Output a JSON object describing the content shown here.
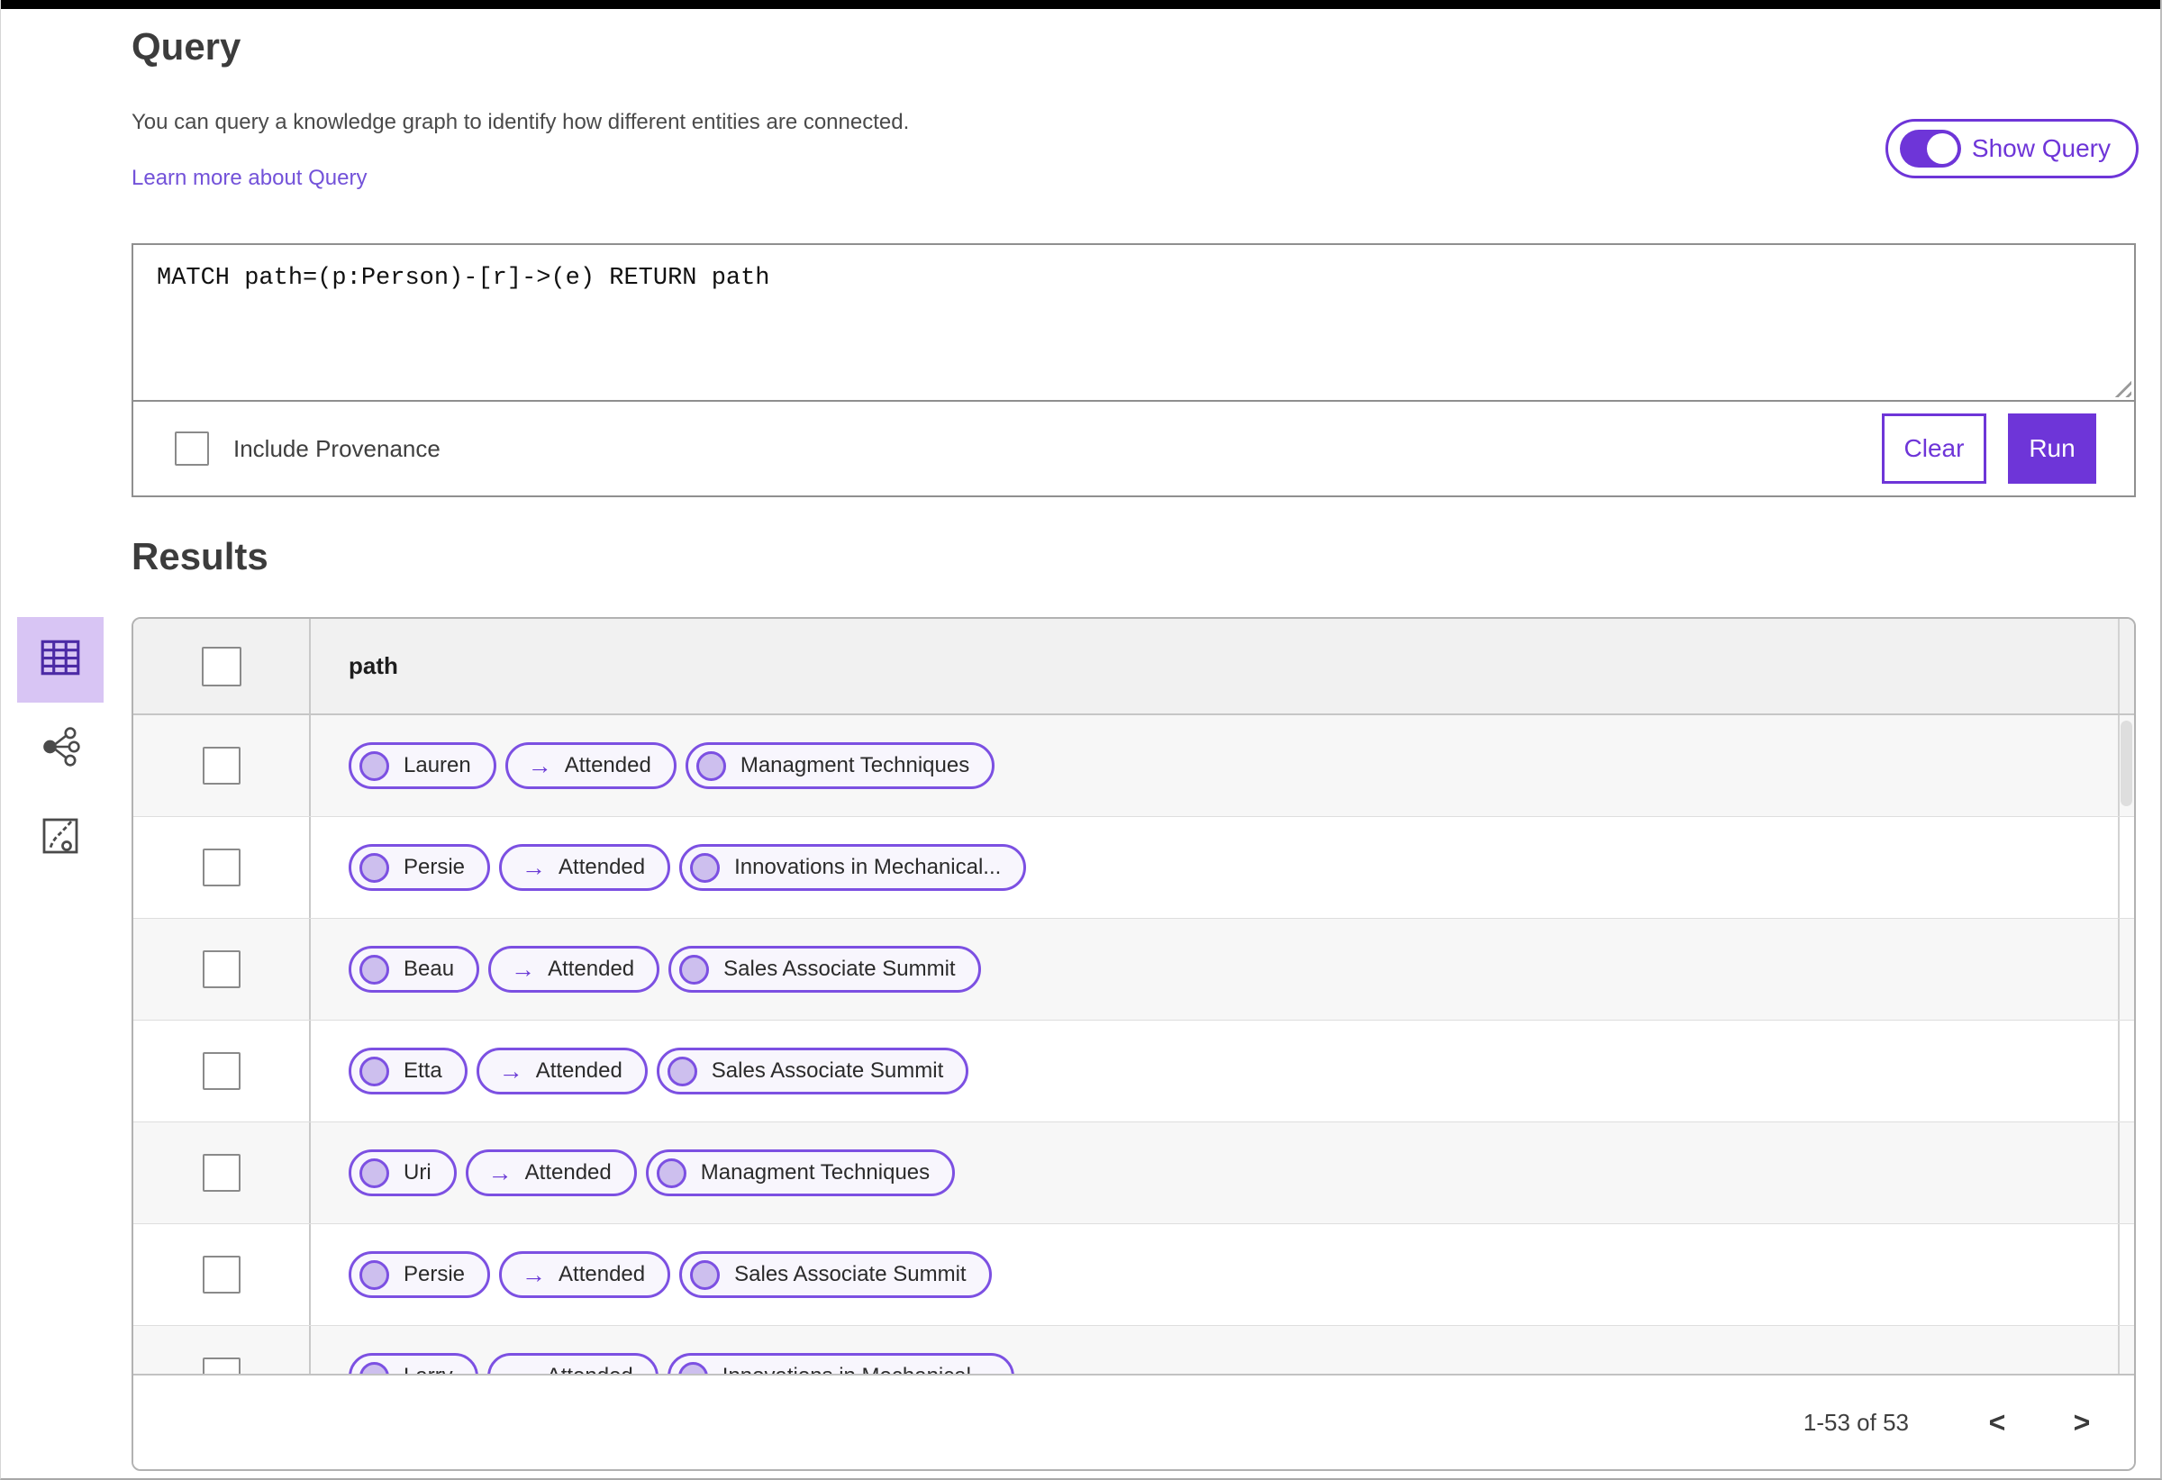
{
  "header": {
    "title": "Query",
    "description": "You can query a knowledge graph to identify how different entities are connected.",
    "learn_more_label": "Learn more about Query",
    "show_query_label": "Show Query",
    "show_query_on": true
  },
  "query_editor": {
    "query_text": "MATCH path=(p:Person)-[r]->(e) RETURN path",
    "include_provenance_label": "Include Provenance",
    "include_provenance_checked": false,
    "clear_button_label": "Clear",
    "run_button_label": "Run"
  },
  "results": {
    "title": "Results",
    "path_column_header": "path",
    "relation_arrow": "→",
    "view_modes": [
      {
        "name": "table-view",
        "selected": true
      },
      {
        "name": "graph-view",
        "selected": false
      },
      {
        "name": "chart-view",
        "selected": false
      }
    ],
    "rows": [
      {
        "source": "Lauren",
        "relation": "Attended",
        "target": "Managment Techniques"
      },
      {
        "source": "Persie",
        "relation": "Attended",
        "target": "Innovations in Mechanical..."
      },
      {
        "source": "Beau",
        "relation": "Attended",
        "target": "Sales Associate Summit"
      },
      {
        "source": "Etta",
        "relation": "Attended",
        "target": "Sales Associate Summit"
      },
      {
        "source": "Uri",
        "relation": "Attended",
        "target": "Managment Techniques"
      },
      {
        "source": "Persie",
        "relation": "Attended",
        "target": "Sales Associate Summit"
      },
      {
        "source": "Larry",
        "relation": "Attended",
        "target": "Innovations in Mechanical..."
      }
    ],
    "pagination": {
      "range_text": "1-53 of 53",
      "prev_icon": "<",
      "next_icon": ">"
    }
  },
  "colors": {
    "accent": "#6e35d8",
    "pill_border": "#7c50e2",
    "pill_bg": "#f8f6fd",
    "node_fill": "#cdbfee",
    "selected_tile_bg": "#d8c5f4",
    "table_header_bg": "#f1f1f1",
    "row_alt_bg": "#f7f7f7",
    "link": "#7352d9"
  }
}
